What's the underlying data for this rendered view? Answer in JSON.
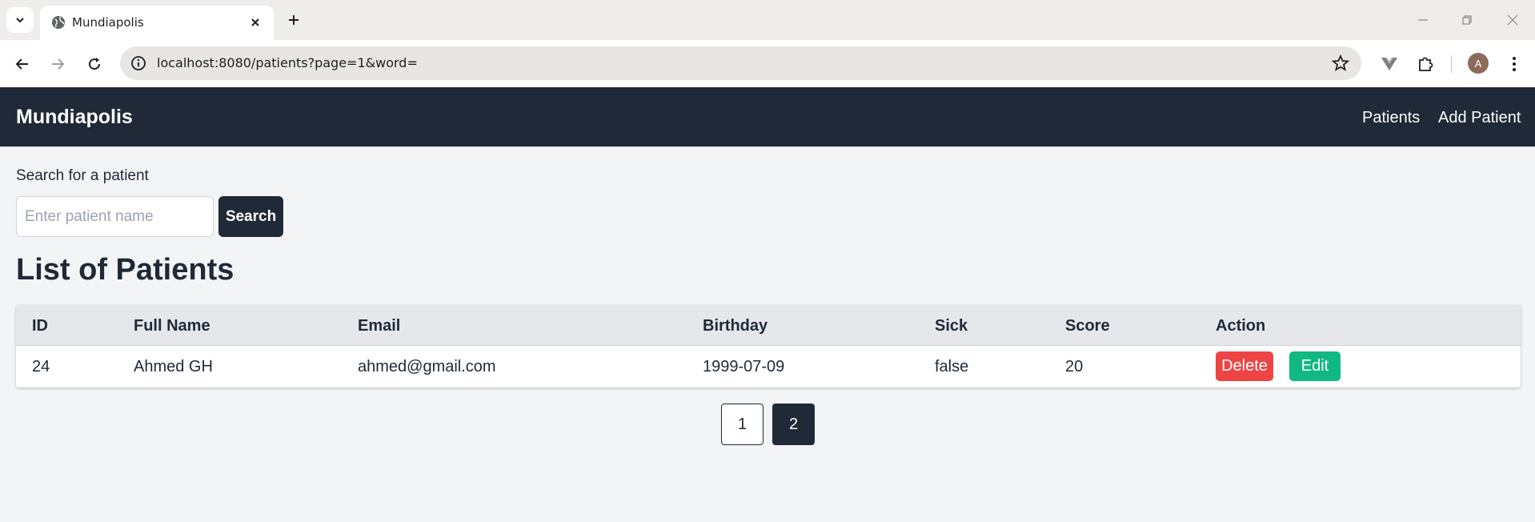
{
  "browser": {
    "tab_title": "Mundiapolis",
    "url": "localhost:8080/patients?page=1&word=",
    "profile_initial": "A"
  },
  "navbar": {
    "brand": "Mundiapolis",
    "links": [
      "Patients",
      "Add Patient"
    ]
  },
  "search": {
    "label": "Search for a patient",
    "placeholder": "Enter patient name",
    "value": "",
    "button_label": "Search"
  },
  "page_title": "List of Patients",
  "table": {
    "columns": [
      "ID",
      "Full Name",
      "Email",
      "Birthday",
      "Sick",
      "Score",
      "Action"
    ],
    "rows": [
      {
        "id": "24",
        "full_name": "Ahmed GH",
        "email": "ahmed@gmail.com",
        "birthday": "1999-07-09",
        "sick": "false",
        "score": "20"
      }
    ],
    "actions": {
      "delete": "Delete",
      "edit": "Edit"
    }
  },
  "pagination": {
    "pages": [
      "1",
      "2"
    ],
    "active_page": "2"
  },
  "colors": {
    "navbar_bg": "#1f2937",
    "delete": "#ef4444",
    "edit": "#10b981"
  }
}
